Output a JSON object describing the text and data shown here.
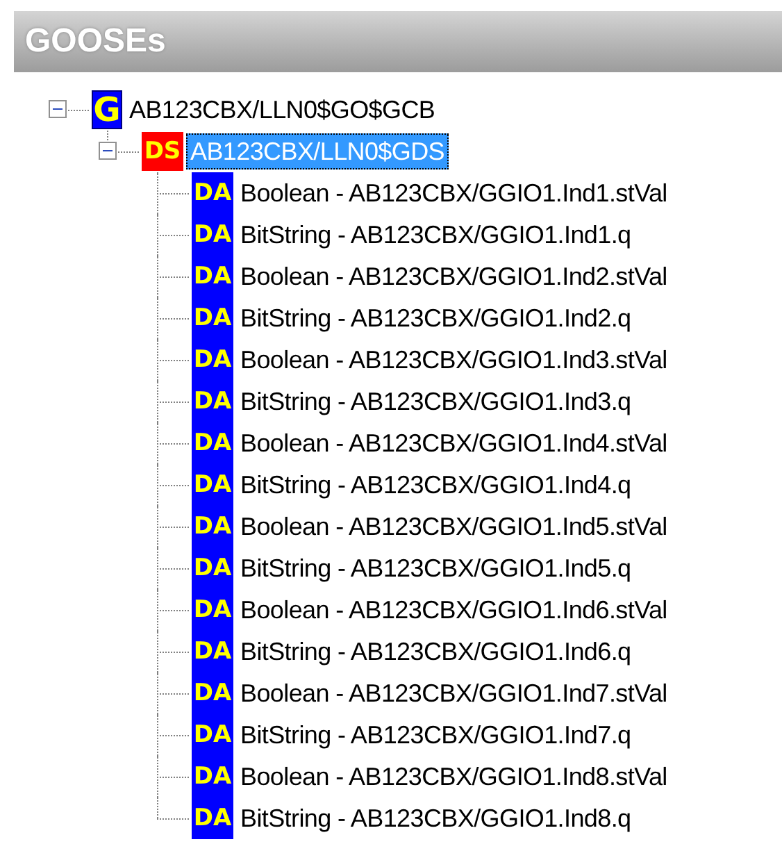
{
  "panel": {
    "title": "GOOSEs"
  },
  "tree": [
    {
      "kind": "gcb",
      "badge": "G",
      "label": "AB123CBX/LLN0$GO$GCB",
      "expanded": true,
      "selected": false,
      "children": [
        {
          "kind": "dataset",
          "badge": "DS",
          "label": "AB123CBX/LLN0$GDS",
          "expanded": true,
          "selected": true,
          "children": [
            {
              "kind": "attribute",
              "badge": "DA",
              "label": "Boolean - AB123CBX/GGIO1.Ind1.stVal",
              "selected": false
            },
            {
              "kind": "attribute",
              "badge": "DA",
              "label": "BitString - AB123CBX/GGIO1.Ind1.q",
              "selected": false
            },
            {
              "kind": "attribute",
              "badge": "DA",
              "label": "Boolean - AB123CBX/GGIO1.Ind2.stVal",
              "selected": false
            },
            {
              "kind": "attribute",
              "badge": "DA",
              "label": "BitString - AB123CBX/GGIO1.Ind2.q",
              "selected": false
            },
            {
              "kind": "attribute",
              "badge": "DA",
              "label": "Boolean - AB123CBX/GGIO1.Ind3.stVal",
              "selected": false
            },
            {
              "kind": "attribute",
              "badge": "DA",
              "label": "BitString - AB123CBX/GGIO1.Ind3.q",
              "selected": false
            },
            {
              "kind": "attribute",
              "badge": "DA",
              "label": "Boolean - AB123CBX/GGIO1.Ind4.stVal",
              "selected": false
            },
            {
              "kind": "attribute",
              "badge": "DA",
              "label": "BitString - AB123CBX/GGIO1.Ind4.q",
              "selected": false
            },
            {
              "kind": "attribute",
              "badge": "DA",
              "label": "Boolean - AB123CBX/GGIO1.Ind5.stVal",
              "selected": false
            },
            {
              "kind": "attribute",
              "badge": "DA",
              "label": "BitString - AB123CBX/GGIO1.Ind5.q",
              "selected": false
            },
            {
              "kind": "attribute",
              "badge": "DA",
              "label": "Boolean - AB123CBX/GGIO1.Ind6.stVal",
              "selected": false
            },
            {
              "kind": "attribute",
              "badge": "DA",
              "label": "BitString - AB123CBX/GGIO1.Ind6.q",
              "selected": false
            },
            {
              "kind": "attribute",
              "badge": "DA",
              "label": "Boolean - AB123CBX/GGIO1.Ind7.stVal",
              "selected": false
            },
            {
              "kind": "attribute",
              "badge": "DA",
              "label": "BitString - AB123CBX/GGIO1.Ind7.q",
              "selected": false
            },
            {
              "kind": "attribute",
              "badge": "DA",
              "label": "Boolean - AB123CBX/GGIO1.Ind8.stVal",
              "selected": false
            },
            {
              "kind": "attribute",
              "badge": "DA",
              "label": "BitString - AB123CBX/GGIO1.Ind8.q",
              "selected": false
            }
          ]
        }
      ]
    }
  ]
}
